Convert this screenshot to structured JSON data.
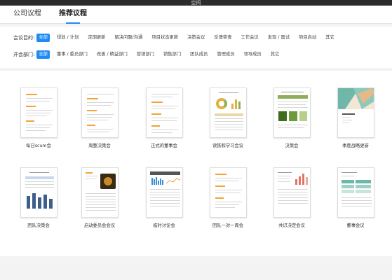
{
  "window": {
    "title": "空间"
  },
  "tabs": [
    {
      "label": "公司议程",
      "active": false
    },
    {
      "label": "推荐议程",
      "active": true
    }
  ],
  "filters": {
    "purpose": {
      "label": "会议目的:",
      "options": [
        "全部",
        "规划 / 计划",
        "定期更新",
        "解决问题/沟通",
        "项目状态更新",
        "决策会议",
        "反馈审查",
        "工作会议",
        "发现 / 面试",
        "项目启动",
        "其它"
      ],
      "selected": "全部"
    },
    "department": {
      "label": "开会部门:",
      "options": [
        "全部",
        "董事 / 委员部门",
        "改善 / 精益部门",
        "营销部门",
        "销售部门",
        "团队成员",
        "管理成员",
        "领导成员",
        "其它"
      ],
      "selected": "全部"
    }
  },
  "templates": [
    {
      "name": "每日scum会",
      "thumb": "doc-lines"
    },
    {
      "name": "周整决策会",
      "thumb": "doc-lines"
    },
    {
      "name": "正式的董事会",
      "thumb": "doc-lines"
    },
    {
      "name": "读铁和学习会议",
      "thumb": "report-donut"
    },
    {
      "name": "决策会",
      "thumb": "report-green"
    },
    {
      "name": "季度战略更新",
      "thumb": "cover-teal"
    },
    {
      "name": "团队决策会",
      "thumb": "report-bars"
    },
    {
      "name": "启动委员会会议",
      "thumb": "report-photo"
    },
    {
      "name": "临时讨论会",
      "thumb": "report-stats"
    },
    {
      "name": "团队一对一周会",
      "thumb": "doc-lines"
    },
    {
      "name": "共识决定会议",
      "thumb": "report-red"
    },
    {
      "name": "董事会议",
      "thumb": "report-table"
    }
  ],
  "colors": {
    "accent": "#1e8bf5",
    "doc_highlight": "#f3a33a",
    "report_green": "#8fae5a",
    "teal": "#6fb7a8"
  }
}
